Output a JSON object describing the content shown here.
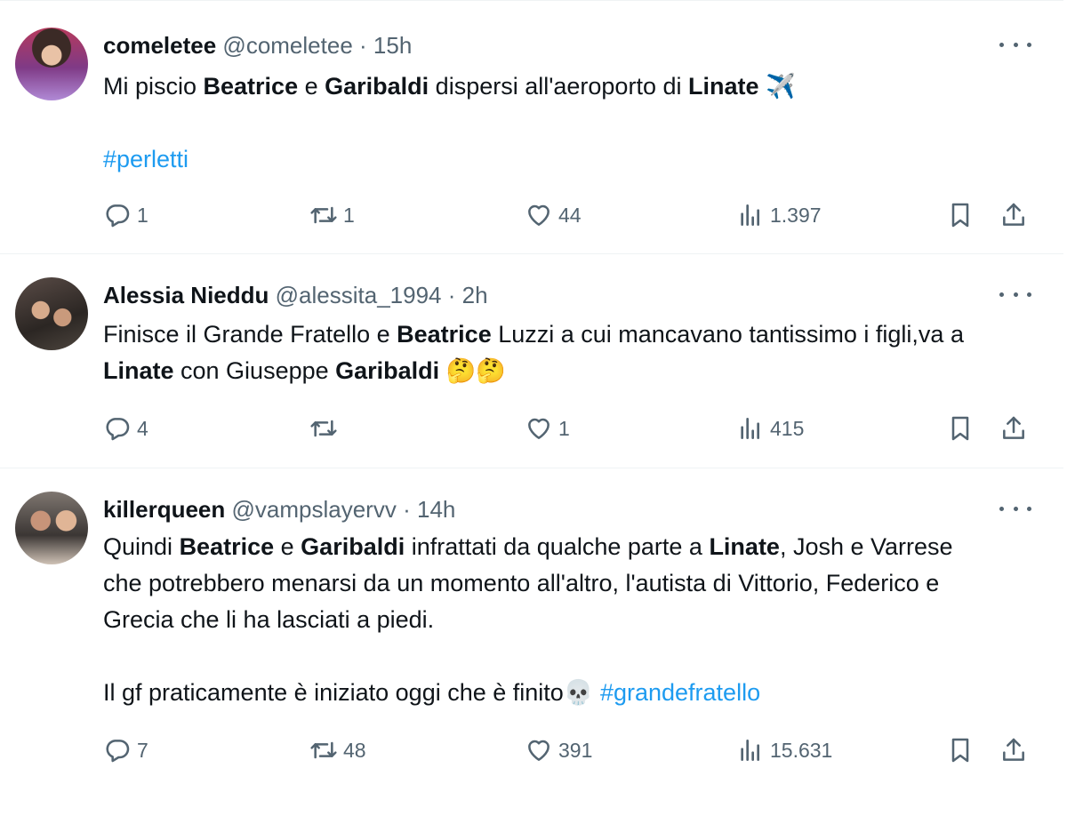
{
  "tweets": [
    {
      "name": "comeletee",
      "handle": "@comeletee",
      "dot": "·",
      "time": "15h",
      "text": {
        "p1": "Mi piscio ",
        "b1": "Beatrice",
        "p2": " e ",
        "b2": "Garibaldi",
        "p3": " dispersi all'aeroporto di ",
        "b3": "Linate",
        "emoji": "✈️",
        "hashtag": "#perletti"
      },
      "stats": {
        "replies": "1",
        "retweets": "1",
        "likes": "44",
        "views": "1.397"
      }
    },
    {
      "name": "Alessia Nieddu",
      "handle": "@alessita_1994",
      "dot": "·",
      "time": "2h",
      "text": {
        "p1": "Finisce il Grande Fratello e ",
        "b1": "Beatrice",
        "p2": " Luzzi a cui mancavano tantissimo i figli,va a ",
        "b2": "Linate",
        "p3": " con Giuseppe ",
        "b3": "Garibaldi",
        "emoji": "🤔🤔"
      },
      "stats": {
        "replies": "4",
        "retweets": "",
        "likes": "1",
        "views": "415"
      }
    },
    {
      "name": "killerqueen",
      "handle": "@vampslayervv",
      "dot": "·",
      "time": "14h",
      "text": {
        "p1": "Quindi ",
        "b1": "Beatrice",
        "p2": " e ",
        "b2": "Garibaldi",
        "p3": " infrattati da qualche parte a ",
        "b3": "Linate",
        "p4": ", Josh e Varrese che potrebbero menarsi da un momento all'altro, l'autista di Vittorio, Federico e Grecia che li ha lasciati a piedi.",
        "p5": "Il gf praticamente è iniziato oggi che è finito",
        "emoji": "💀",
        "hashtag": "#grandefratello"
      },
      "stats": {
        "replies": "7",
        "retweets": "48",
        "likes": "391",
        "views": "15.631"
      }
    }
  ],
  "icons": {
    "reply": "reply-icon",
    "retweet": "retweet-icon",
    "like": "heart-icon",
    "views": "views-icon",
    "bookmark": "bookmark-icon",
    "share": "share-icon",
    "more": "more-icon"
  },
  "colors": {
    "text": "#0f1419",
    "muted": "#536471",
    "link": "#1d9bf0",
    "divider": "#eff3f4"
  }
}
